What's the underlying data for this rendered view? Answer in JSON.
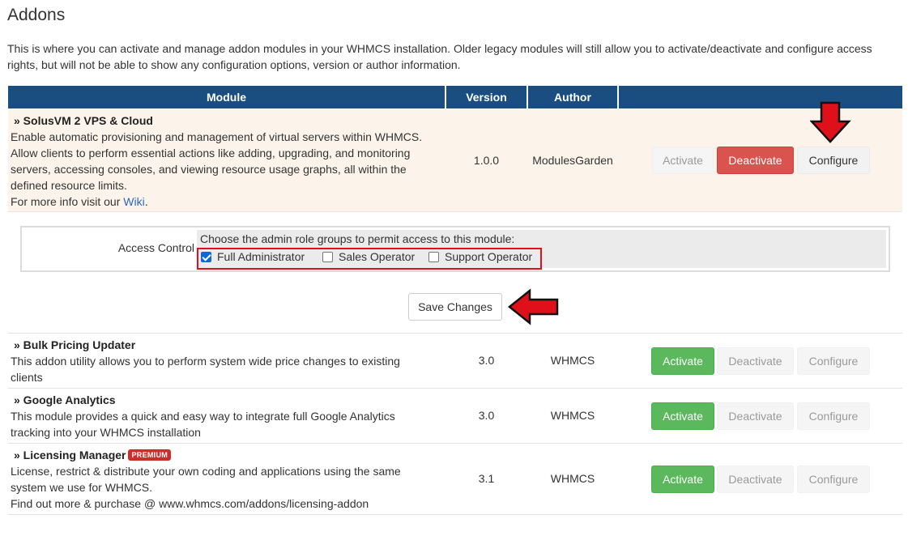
{
  "page": {
    "title": "Addons",
    "intro": "This is where you can activate and manage addon modules in your WHMCS installation. Older legacy modules will still allow you to activate/deactivate and configure access rights, but will not be able to show any configuration options, version or author information."
  },
  "table": {
    "headers": {
      "module": "Module",
      "version": "Version",
      "author": "Author",
      "actions": ""
    },
    "rows": [
      {
        "name": "» SolusVM 2 VPS & Cloud",
        "desc_lines": [
          "Enable automatic provisioning and management of virtual servers within WHMCS.",
          "Allow clients to perform essential actions like adding, upgrading, and monitoring",
          "servers, accessing consoles, and viewing resource usage graphs, all within the",
          "defined resource limits."
        ],
        "more_info_prefix": "For more info visit our ",
        "more_info_link": "Wiki",
        "more_info_suffix": ".",
        "version": "1.0.0",
        "author": "ModulesGarden",
        "activate": "Activate",
        "deactivate": "Deactivate",
        "configure": "Configure"
      },
      {
        "name": "» Bulk Pricing Updater",
        "desc_lines": [
          "This addon utility allows you to perform system wide price changes to existing",
          "clients"
        ],
        "version": "3.0",
        "author": "WHMCS",
        "activate": "Activate",
        "deactivate": "Deactivate",
        "configure": "Configure"
      },
      {
        "name": "» Google Analytics",
        "desc_lines": [
          "This module provides a quick and easy way to integrate full Google Analytics",
          "tracking into your WHMCS installation"
        ],
        "version": "3.0",
        "author": "WHMCS",
        "activate": "Activate",
        "deactivate": "Deactivate",
        "configure": "Configure"
      },
      {
        "name": "» Licensing Manager",
        "badge": "PREMIUM",
        "desc_lines": [
          "License, restrict & distribute your own coding and applications using the same",
          "system we use for WHMCS.",
          "Find out more & purchase @ www.whmcs.com/addons/licensing-addon"
        ],
        "version": "3.1",
        "author": "WHMCS",
        "activate": "Activate",
        "deactivate": "Deactivate",
        "configure": "Configure"
      }
    ]
  },
  "access_control": {
    "label": "Access Control",
    "prompt": "Choose the admin role groups to permit access to this module:",
    "options": [
      {
        "label": "Full Administrator",
        "checked": true
      },
      {
        "label": "Sales Operator",
        "checked": false
      },
      {
        "label": "Support Operator",
        "checked": false
      }
    ]
  },
  "save_label": "Save Changes",
  "colors": {
    "header_bg": "#1a4d80",
    "active_row_bg": "#fcf4ea",
    "danger": "#d9534f",
    "success": "#5cb85c",
    "annotation_red": "#e0101a"
  },
  "icons": [
    "arrow-down-annotation-icon",
    "arrow-left-annotation-icon",
    "checkbox-checked-icon"
  ]
}
